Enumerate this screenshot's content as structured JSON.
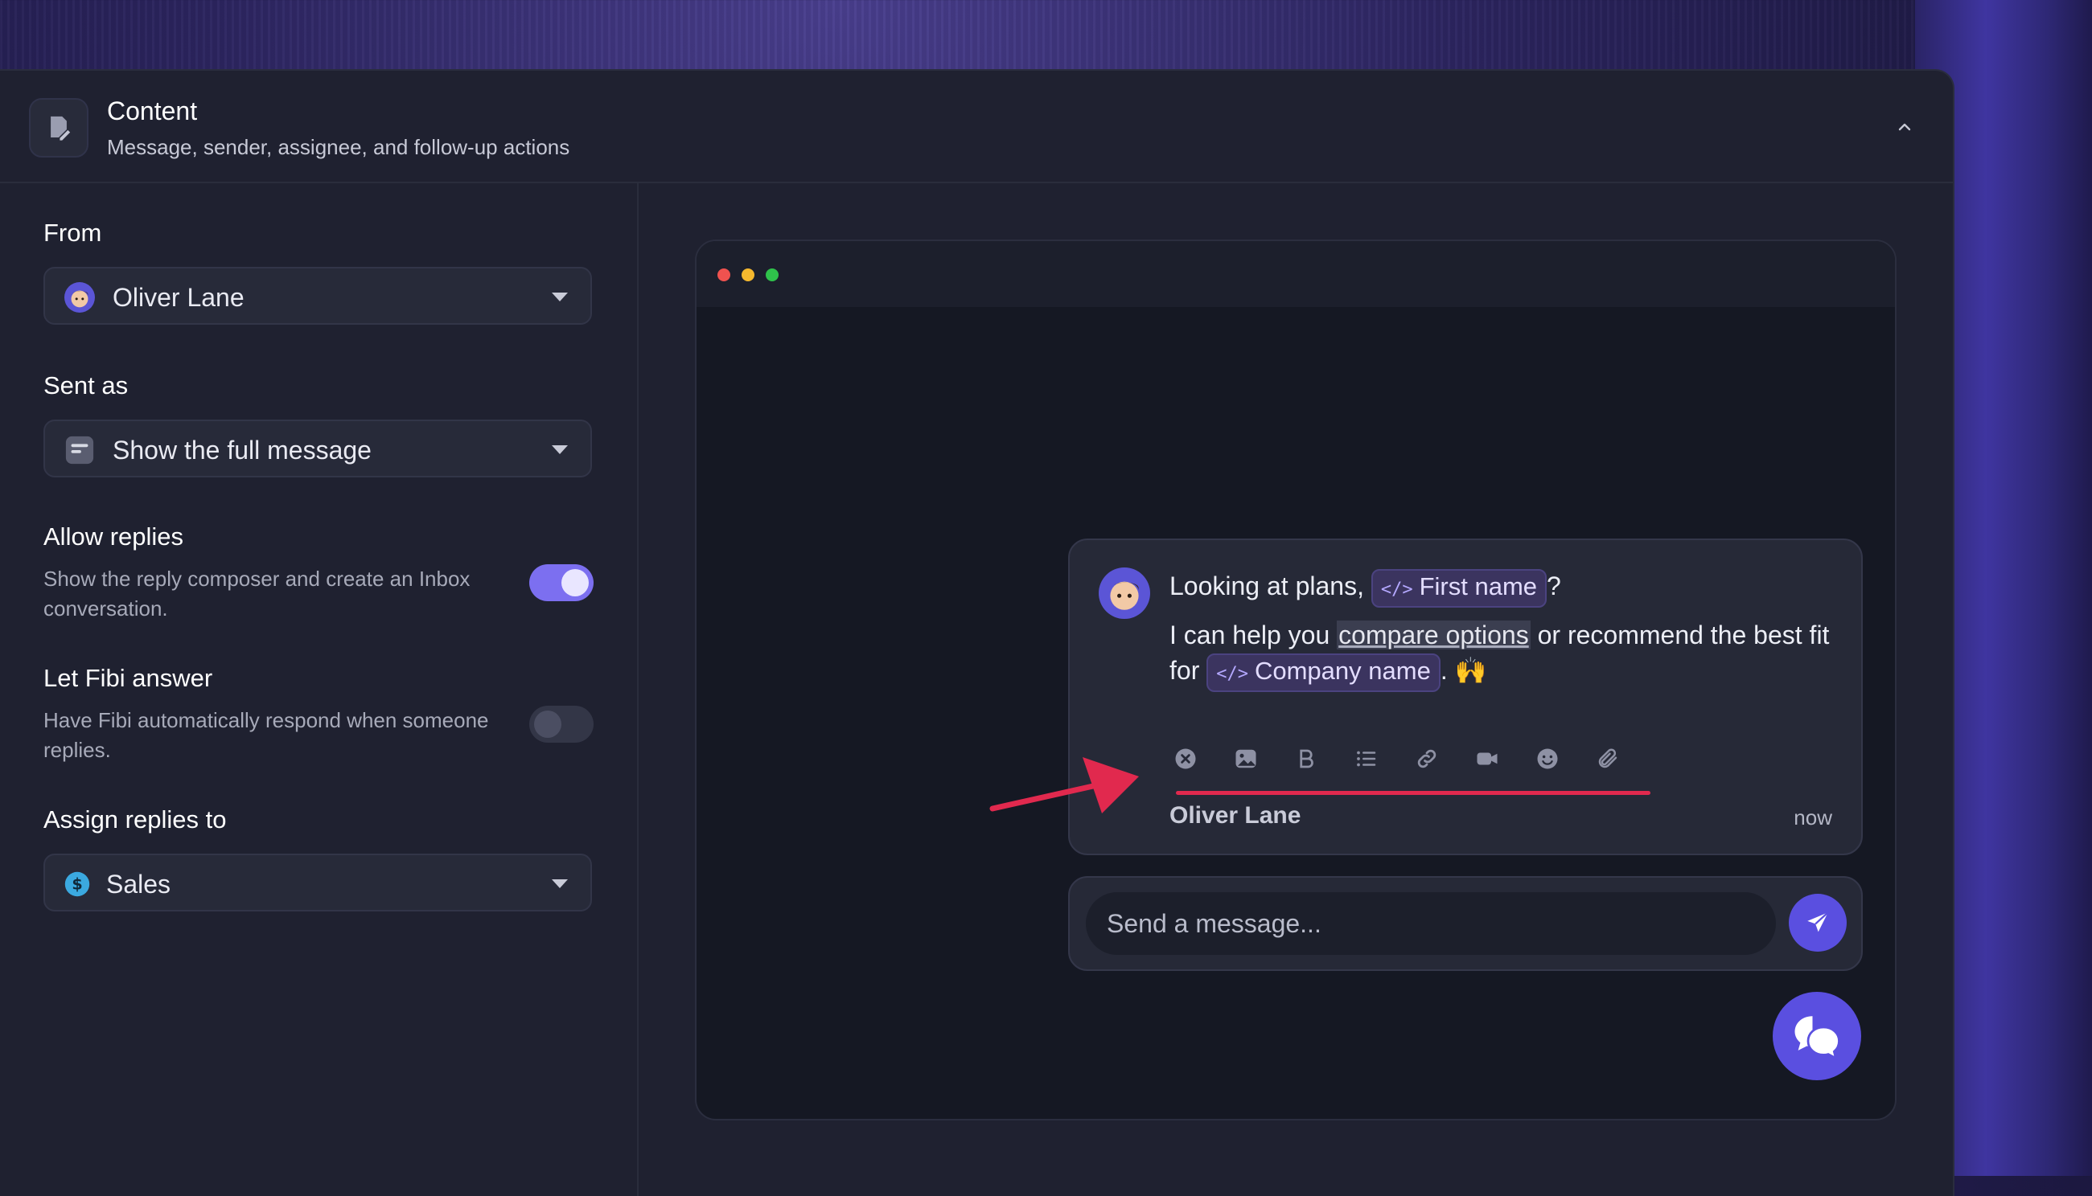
{
  "header": {
    "title": "Content",
    "subtitle": "Message, sender, assignee, and follow-up actions"
  },
  "form": {
    "from": {
      "label": "From",
      "value": "Oliver Lane"
    },
    "sent_as": {
      "label": "Sent as",
      "value": "Show the full message"
    },
    "allow_replies": {
      "label": "Allow replies",
      "help": "Show the reply composer and create an Inbox conversation.",
      "enabled": true
    },
    "let_fibi_answer": {
      "label": "Let Fibi answer",
      "help": "Have Fibi automatically respond when someone replies.",
      "enabled": false
    },
    "assign_replies_to": {
      "label": "Assign replies to",
      "value": "Sales"
    }
  },
  "preview": {
    "message": {
      "line1_prefix": "Looking at plans, ",
      "first_name_chip": "First name",
      "line1_suffix": "?",
      "line2_prefix": "I can help you ",
      "link_text": "compare options",
      "line2_middle": " or recommend the best fit for ",
      "company_chip": "Company name",
      "line2_suffix": ". 🙌",
      "sender": "Oliver Lane",
      "time": "now"
    },
    "toolbar_icons": [
      "remove-icon",
      "image-icon",
      "bold-icon",
      "list-icon",
      "link-icon",
      "video-icon",
      "emoji-icon",
      "attachment-icon"
    ],
    "composer": {
      "placeholder": "Send a message..."
    }
  },
  "colors": {
    "accent": "#5a4fe0",
    "toggle_on": "#7c6ff0",
    "annotation": "#e1294e"
  }
}
